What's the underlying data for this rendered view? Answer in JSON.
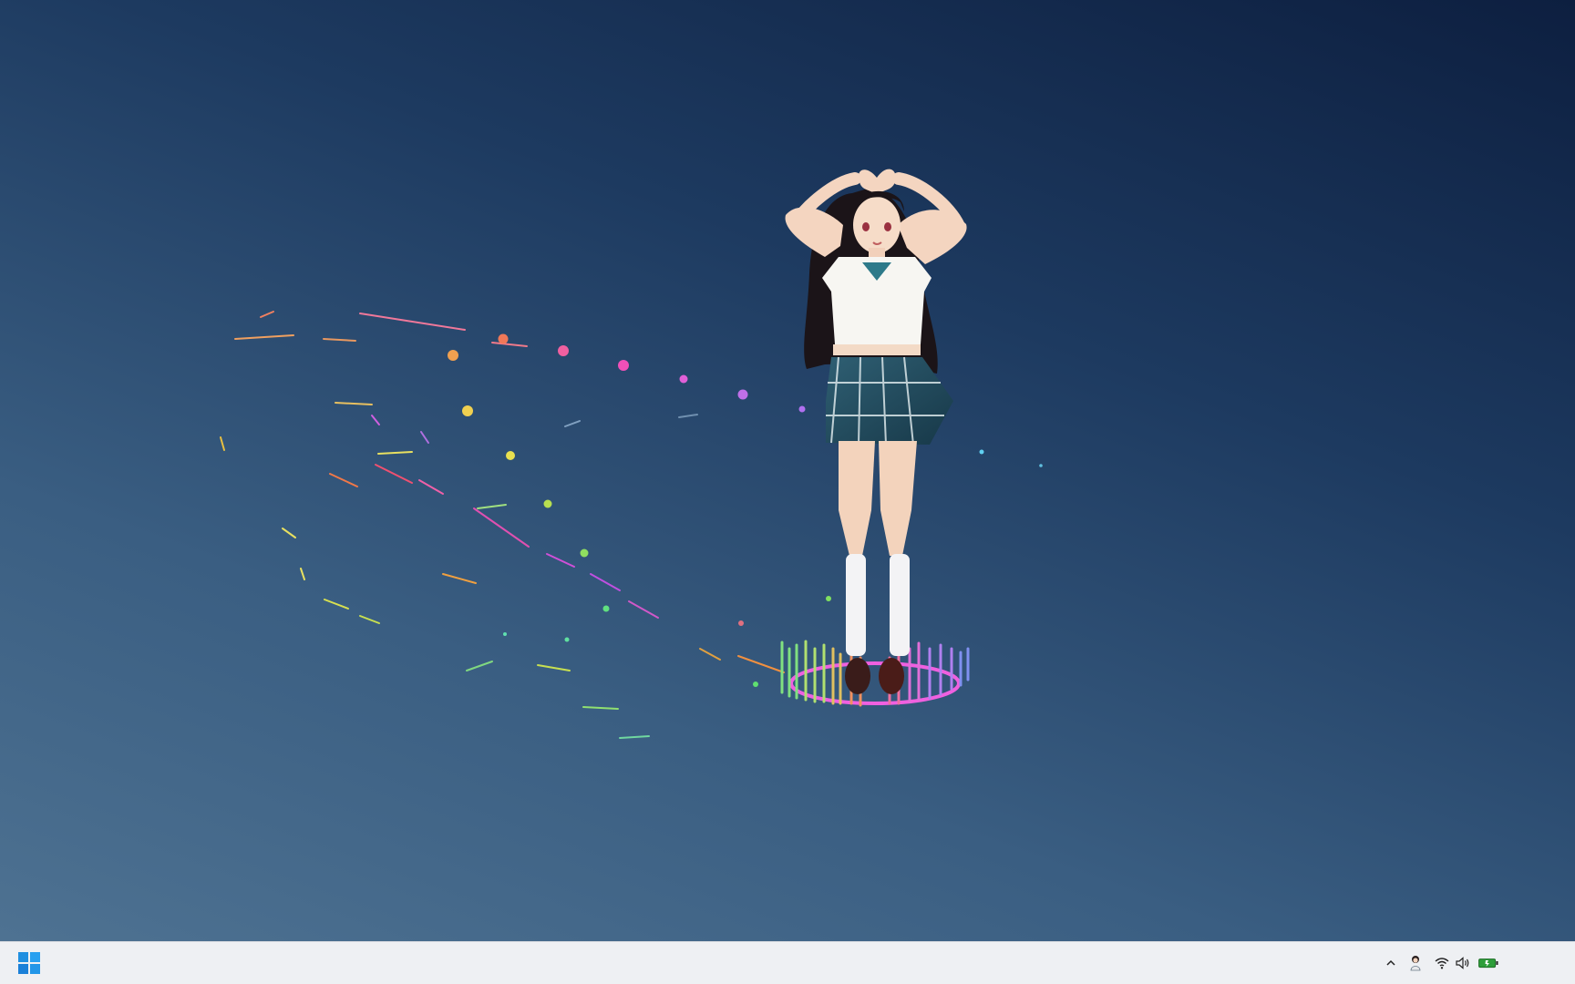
{
  "desktop": {
    "wallpaper": "animated-anime-character-wallpaper",
    "colors": {
      "top": "#0d1f40",
      "bottom": "#4e7292"
    }
  },
  "taskbar": {
    "start_icon": "windows-start-icon",
    "tray": {
      "icons": [
        "chevron-up-icon",
        "avatar-icon",
        "wifi-icon",
        "volume-icon",
        "battery-icon"
      ],
      "battery_color": "#2e9e3a"
    },
    "clock": {
      "time": "",
      "date": ""
    }
  }
}
